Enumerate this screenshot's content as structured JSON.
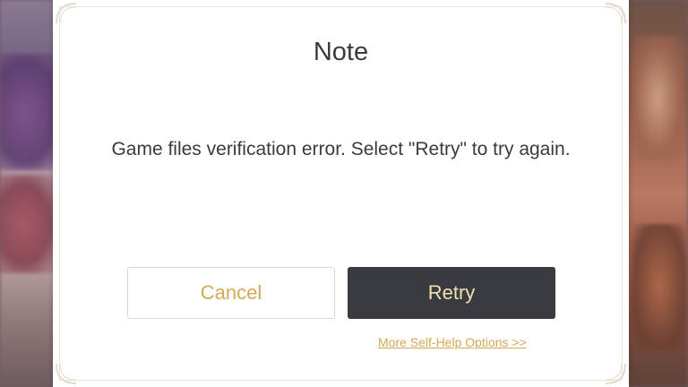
{
  "dialog": {
    "title": "Note",
    "message": "Game files verification error. Select \"Retry\" to try again.",
    "cancel_label": "Cancel",
    "retry_label": "Retry",
    "help_link": "More Self-Help Options >>"
  },
  "colors": {
    "accent_gold": "#d2a955",
    "retry_bg": "#393b40",
    "retry_text": "#f3dfb2",
    "text_dark": "#3a3b3f"
  }
}
